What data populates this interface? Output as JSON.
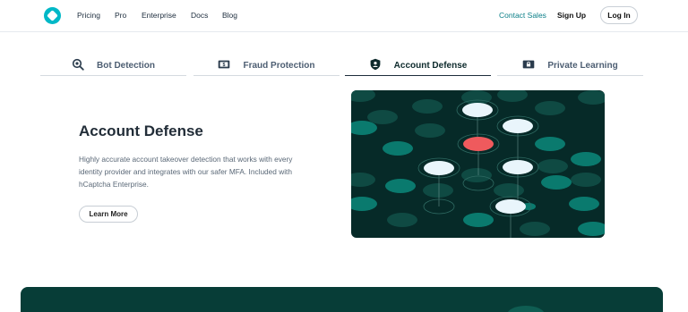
{
  "header": {
    "nav": [
      "Pricing",
      "Pro",
      "Enterprise",
      "Docs",
      "Blog"
    ],
    "contact_sales": "Contact Sales",
    "sign_up": "Sign Up",
    "log_in": "Log In"
  },
  "tabs": [
    {
      "label": "Bot Detection",
      "icon": "magnifier-bot-icon",
      "active": false
    },
    {
      "label": "Fraud Protection",
      "icon": "dollar-card-icon",
      "active": false
    },
    {
      "label": "Account Defense",
      "icon": "shield-user-icon",
      "active": true
    },
    {
      "label": "Private Learning",
      "icon": "lock-card-icon",
      "active": false
    }
  ],
  "content": {
    "title": "Account Defense",
    "description": "Highly accurate account takeover detection that works with every identity provider and integrates with our safer MFA. Included with hCaptcha Enterprise.",
    "learn_more": "Learn More"
  },
  "colors": {
    "accent": "#0b7f88",
    "illustration_bg": "#062a28",
    "node_teal": "#0a7a6e",
    "node_dark": "#0f4a43",
    "node_highlight": "#e9f5fb",
    "node_alert": "#ef5a5d",
    "banner_bg": "#073d37"
  }
}
